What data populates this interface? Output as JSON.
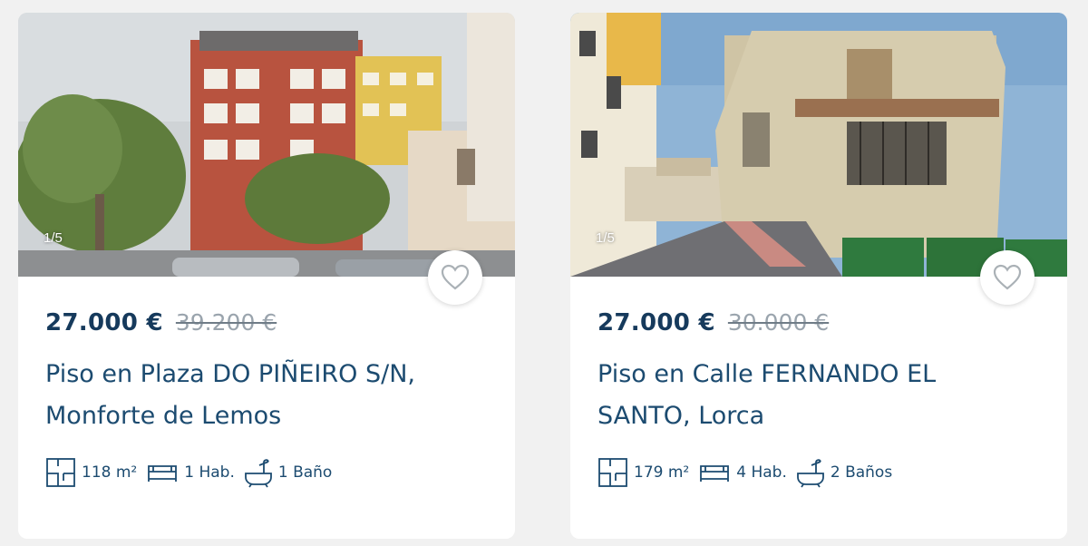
{
  "listings": [
    {
      "photo_counter": "1/5",
      "price": "27.000 €",
      "old_price": "39.200 €",
      "title": "Piso en Plaza DO PIÑEIRO S/N, Monforte de Lemos",
      "features": {
        "area": "118 m²",
        "rooms": "1 Hab.",
        "baths": "1 Baño"
      },
      "icons": [
        "floorplan-icon",
        "bed-icon",
        "bathtub-icon",
        "heart-outline-icon"
      ]
    },
    {
      "photo_counter": "1/5",
      "price": "27.000 €",
      "old_price": "30.000 €",
      "title": "Piso en Calle FERNANDO EL SANTO, Lorca",
      "features": {
        "area": "179 m²",
        "rooms": "4 Hab.",
        "baths": "2 Baños"
      },
      "icons": [
        "floorplan-icon",
        "bed-icon",
        "bathtub-icon",
        "heart-outline-icon"
      ]
    }
  ],
  "colors": {
    "price": "#163a5c",
    "title": "#1c4b70",
    "old_price": "#9aa4ad",
    "background": "#f1f1f1"
  }
}
